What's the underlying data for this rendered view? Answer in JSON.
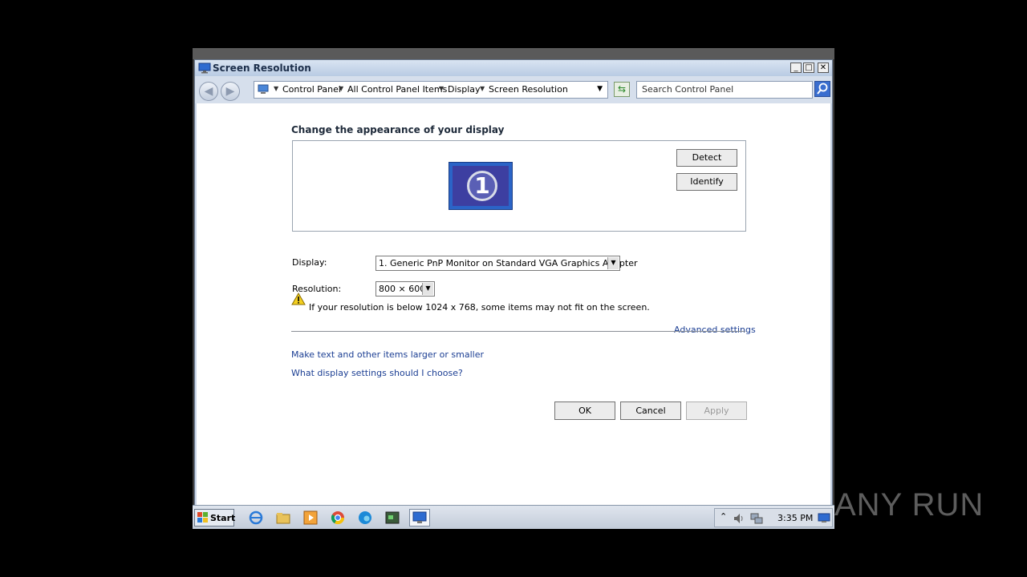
{
  "window": {
    "title": "Screen Resolution",
    "controls": {
      "minimize": "_",
      "maximize": "□",
      "close": "✕"
    }
  },
  "navbar": {
    "breadcrumbs": [
      "Control Panel",
      "All Control Panel Items",
      "Display",
      "Screen Resolution"
    ],
    "search_placeholder": "Search Control Panel"
  },
  "content": {
    "heading": "Change the appearance of your display",
    "monitor_number": "1",
    "detect_label": "Detect",
    "identify_label": "Identify",
    "display_label": "Display:",
    "display_value": "1. Generic PnP Monitor on Standard VGA Graphics Adapter",
    "resolution_label": "Resolution:",
    "resolution_value": "800 × 600",
    "warning_text": "If your resolution is below 1024 x 768, some items may not fit on the screen.",
    "advanced_settings_link": "Advanced settings",
    "link_text_size": "Make text and other items larger or smaller",
    "link_display_help": "What display settings should I choose?",
    "ok_label": "OK",
    "cancel_label": "Cancel",
    "apply_label": "Apply"
  },
  "taskbar": {
    "start_label": "Start",
    "clock": "3:35 PM",
    "icons": [
      "internet-explorer-icon",
      "folder-icon",
      "media-player-icon",
      "chrome-icon",
      "edge-icon",
      "terminal-icon",
      "display-settings-icon"
    ]
  },
  "watermark": "ANY RUN",
  "colors": {
    "link": "#1b3e93",
    "title_bar": "#b9cbe3",
    "monitor_blue": "#2b64c7"
  }
}
